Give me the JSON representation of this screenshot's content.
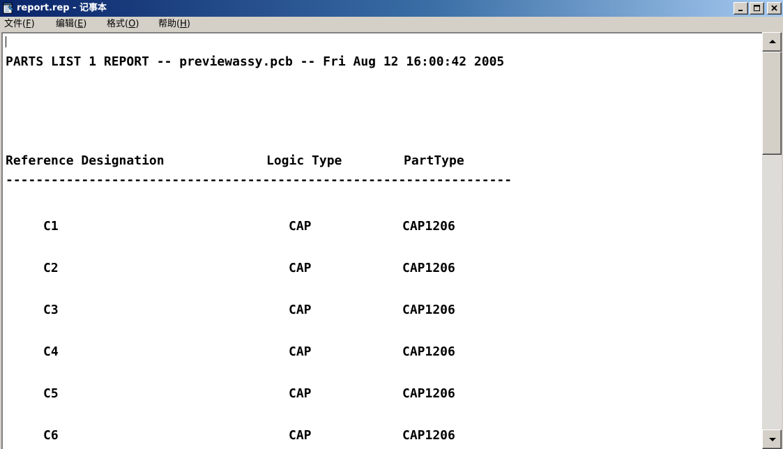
{
  "window": {
    "title": "report.rep - 记事本",
    "icon": "notepad-icon"
  },
  "menu": [
    {
      "label": "文件(",
      "accel": "F",
      "tail": ")"
    },
    {
      "label": "编辑(",
      "accel": "E",
      "tail": ")"
    },
    {
      "label": "格式(",
      "accel": "O",
      "tail": ")"
    },
    {
      "label": "帮助(",
      "accel": "H",
      "tail": ")"
    }
  ],
  "document": {
    "header_line": "PARTS LIST 1 REPORT -- previewassy.pcb -- Fri Aug 12 16:00:42 2005",
    "columns": {
      "ref": "Reference Designation",
      "logic": "Logic Type",
      "part": "PartType"
    },
    "separator": "-------------------------------------------------------------------",
    "rows": [
      {
        "ref": "C1",
        "logic": "CAP",
        "part": "CAP1206"
      },
      {
        "ref": "C2",
        "logic": "CAP",
        "part": "CAP1206"
      },
      {
        "ref": "C3",
        "logic": "CAP",
        "part": "CAP1206"
      },
      {
        "ref": "C4",
        "logic": "CAP",
        "part": "CAP1206"
      },
      {
        "ref": "C5",
        "logic": "CAP",
        "part": "CAP1206"
      },
      {
        "ref": "C6",
        "logic": "CAP",
        "part": "CAP1206"
      }
    ]
  },
  "colors": {
    "titlebar_start": "#0a246a",
    "titlebar_end": "#a6caf0",
    "chrome": "#d4d0c8"
  }
}
